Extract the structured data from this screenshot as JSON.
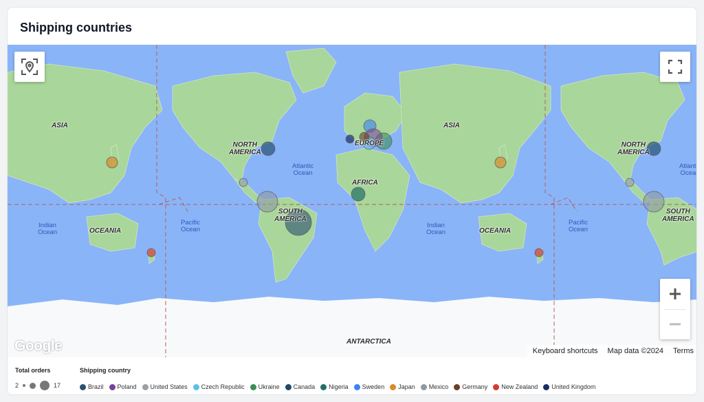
{
  "card": {
    "title": "Shipping countries"
  },
  "map": {
    "labels": {
      "asia": "ASIA",
      "north_america": "NORTH\nAMERICA",
      "south_america": "SOUTH\nAMERICA",
      "europe": "EUROPE",
      "africa": "AFRICA",
      "oceania": "OCEANIA",
      "antarctica": "ANTARCTICA",
      "atlantic_ocean": "Atlantic\nOcean",
      "indian_ocean": "Indian\nOcean",
      "pacific_ocean": "Pacific\nOcean"
    },
    "google_logo": "Google",
    "attribution": {
      "shortcuts": "Keyboard shortcuts",
      "map_data": "Map data ©2024",
      "terms": "Terms"
    },
    "controls": {
      "zoom_in": "+",
      "zoom_out": "−"
    },
    "icons": {
      "location": "location-frame-icon",
      "fullscreen": "fullscreen-icon"
    }
  },
  "legend": {
    "total_orders_title": "Total orders",
    "size_min": "2",
    "size_max": "17",
    "shipping_country_title": "Shipping country",
    "countries": [
      {
        "name": "Brazil",
        "color": "#2d4f72"
      },
      {
        "name": "Poland",
        "color": "#7b3f9e"
      },
      {
        "name": "United States",
        "color": "#9aa0a6"
      },
      {
        "name": "Czech Republic",
        "color": "#5bc0eb"
      },
      {
        "name": "Ukraine",
        "color": "#3c8d56"
      },
      {
        "name": "Canada",
        "color": "#1f4a6b"
      },
      {
        "name": "Nigeria",
        "color": "#226f6a"
      },
      {
        "name": "Sweden",
        "color": "#3b82f6"
      },
      {
        "name": "Japan",
        "color": "#d88b2a"
      },
      {
        "name": "Mexico",
        "color": "#8f9aa3"
      },
      {
        "name": "Germany",
        "color": "#6b3e26"
      },
      {
        "name": "New Zealand",
        "color": "#d33b33"
      },
      {
        "name": "United Kingdom",
        "color": "#1c2c66"
      }
    ]
  }
}
